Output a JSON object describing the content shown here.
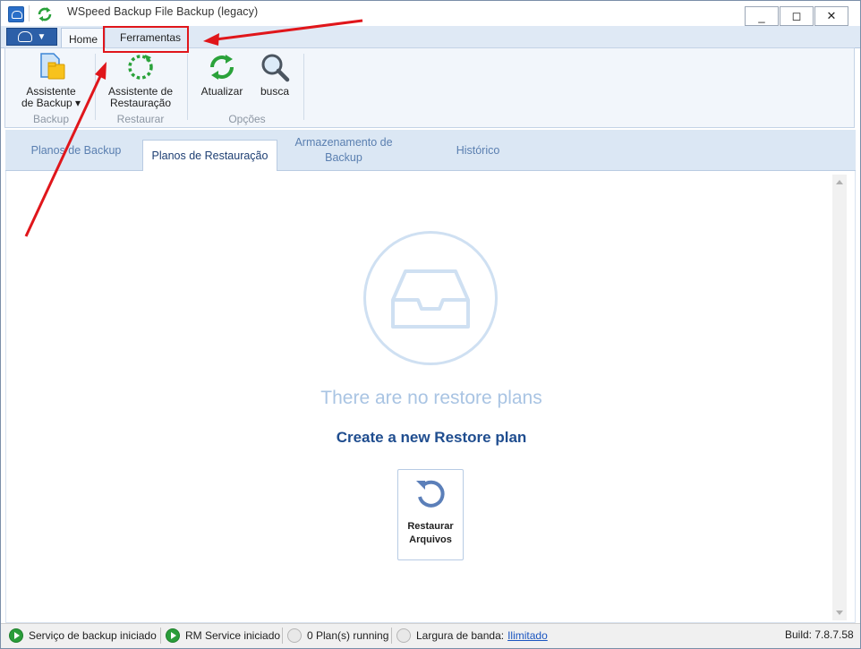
{
  "window": {
    "title": "WSpeed Backup File Backup (legacy)",
    "min_label": "_",
    "max_label": "◻",
    "close_label": "✕"
  },
  "ribbon": {
    "tabs": [
      {
        "label": "Home"
      },
      {
        "label": "Ferramentas"
      }
    ],
    "groups": [
      {
        "label": "Backup",
        "buttons": [
          {
            "label": "Assistente de Backup ▾",
            "icon": "backup-wizard-icon"
          }
        ]
      },
      {
        "label": "Restaurar",
        "buttons": [
          {
            "label": "Assistente de Restauração",
            "icon": "restore-wizard-icon"
          }
        ]
      },
      {
        "label": "Opções",
        "buttons": [
          {
            "label": "Atualizar",
            "icon": "refresh-icon"
          },
          {
            "label": "busca",
            "icon": "search-icon"
          }
        ]
      }
    ]
  },
  "content_tabs": [
    {
      "label": "Planos de Backup",
      "active": false
    },
    {
      "label": "Planos de Restauração",
      "active": true
    },
    {
      "label": "Armazenamento de Backup",
      "active": false
    },
    {
      "label": "Histórico",
      "active": false
    }
  ],
  "main": {
    "empty_message": "There are no restore plans",
    "create_link": "Create a new Restore plan",
    "restore_tile_label": "Restaurar Arquivos"
  },
  "statusbar": {
    "backup_service": "Serviço de backup iniciado",
    "rm_service": "RM Service iniciado",
    "plans_running": "0 Plan(s) running",
    "bandwidth_label": "Largura de banda:",
    "bandwidth_value": "Ilimitado",
    "build": "Build: 7.8.7.58"
  },
  "colors": {
    "accent": "#2c5fa8",
    "annotation_red": "#e0161b",
    "status_green": "#2a9d3a"
  }
}
